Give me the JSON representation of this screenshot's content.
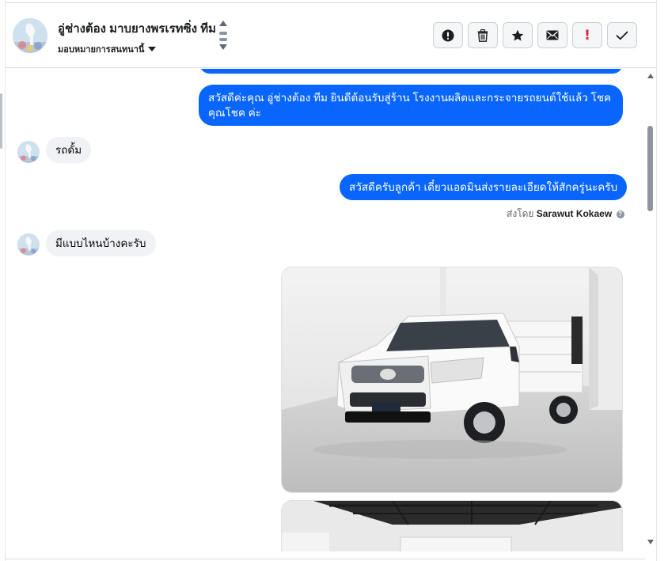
{
  "header": {
    "contact_name": "อู่ช่างต้อง มาบยางพรเรทซิ่ง ทีม",
    "assign_label": "มอบหมายการสนทนานี้",
    "actions": [
      {
        "name": "spam-button",
        "icon": "alert-circle-icon"
      },
      {
        "name": "delete-button",
        "icon": "trash-icon"
      },
      {
        "name": "star-button",
        "icon": "star-icon"
      },
      {
        "name": "mark-unread-button",
        "icon": "envelope-icon"
      },
      {
        "name": "follow-up-button",
        "icon": "exclamation-icon",
        "glyph": "!"
      },
      {
        "name": "mark-done-button",
        "icon": "checkmark-icon"
      }
    ]
  },
  "messages": [
    {
      "from": "page",
      "text": "สวัสดีค่ะคุณ อู่ช่างต้อง ทีม ยินดีต้อนรับสู่ร้าน โรงงานผลิตและกระจายรถยนต์ใช้แล้ว โชคคุณโชค ค่ะ"
    },
    {
      "from": "customer",
      "text": "รถดั้ม"
    },
    {
      "from": "page",
      "text": "สวัสดีครับลูกค้า เดี๋ยวแอดมินส่งรายละเอียดให้สักครู่นะครับ"
    },
    {
      "from": "customer",
      "text": "มีแบบไหนบ้างคะรับ"
    }
  ],
  "sent_by": {
    "prefix": "ส่งโดย",
    "name": "Sarawut Kokaew"
  },
  "photos": [
    {
      "subject": "white-pickup-dump-truck-photo"
    },
    {
      "subject": "truck-in-showroom-photo"
    }
  ],
  "colors": {
    "outgoing_bubble": "#0866ff",
    "incoming_bubble": "#f0f2f5",
    "follow_up_icon": "#e41e3f"
  }
}
